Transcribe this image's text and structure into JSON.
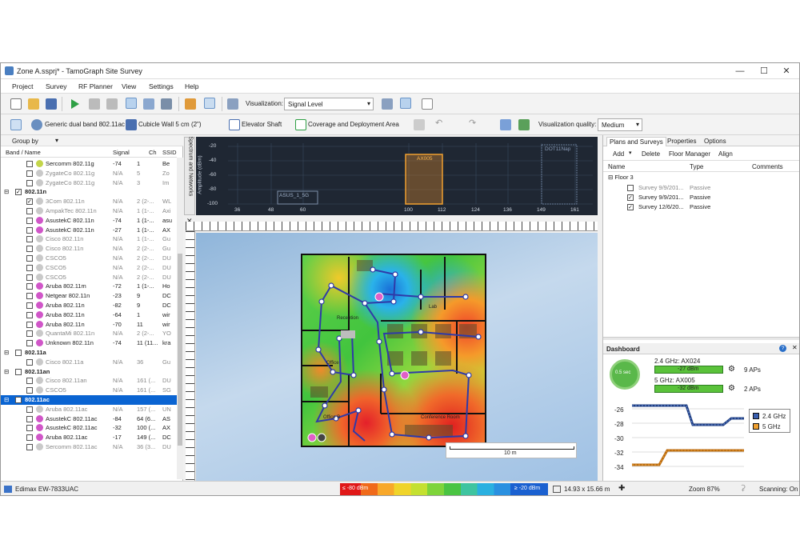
{
  "window": {
    "title": "Zone A.ssprj* - TamoGraph Site Survey"
  },
  "menu": [
    "Project",
    "Survey",
    "RF Planner",
    "View",
    "Settings",
    "Help"
  ],
  "toolbar1": {
    "visualization_label": "Visualization:",
    "visualization_value": "Signal Level"
  },
  "toolbar2": {
    "ap_model": "Generic dual band 802.11ac",
    "wall": "Cubicle Wall 5 cm (2\")",
    "elevator": "Elevator Shaft",
    "coverage": "Coverage and Deployment Area",
    "quality_label": "Visualization quality:",
    "quality_value": "Medium"
  },
  "left": {
    "group_by": "Group by",
    "headers": [
      "Band / Name",
      "Signal",
      "Ch",
      "SSID"
    ],
    "rows": [
      {
        "name": "Sercomm 802.11g",
        "signal": "-74",
        "ch": "1",
        "ssid": "Be",
        "indent": 2,
        "dot": "#c3d54a",
        "gray": false
      },
      {
        "name": "ZygateCo 802.11g",
        "signal": "N/A",
        "ch": "5",
        "ssid": "Zo",
        "indent": 2,
        "dot": "#c9c9c9",
        "gray": true
      },
      {
        "name": "ZygateCo 802.11g",
        "signal": "N/A",
        "ch": "3",
        "ssid": "Im",
        "indent": 2,
        "dot": "#c9c9c9",
        "gray": true
      },
      {
        "name": "802.11n",
        "signal": "",
        "ch": "",
        "ssid": "",
        "indent": 0,
        "group": true,
        "checked": true
      },
      {
        "name": "3Com 802.11n",
        "signal": "N/A",
        "ch": "2 (2-...",
        "ssid": "WL",
        "indent": 2,
        "dot": "#c9c9c9",
        "gray": true,
        "checked": true
      },
      {
        "name": "AmpakTec 802.11n",
        "signal": "N/A",
        "ch": "1 (1-...",
        "ssid": "Axi",
        "indent": 2,
        "dot": "#c9c9c9",
        "gray": true
      },
      {
        "name": "AsustekC 802.11n",
        "signal": "-74",
        "ch": "1 (1-...",
        "ssid": "asu",
        "indent": 2,
        "dot": "#d056c8",
        "gray": false
      },
      {
        "name": "AsustekC 802.11n",
        "signal": "-27",
        "ch": "1 (1-...",
        "ssid": "AX",
        "indent": 2,
        "dot": "#d056c8",
        "gray": false
      },
      {
        "name": "Cisco 802.11n",
        "signal": "N/A",
        "ch": "1 (1-...",
        "ssid": "Gu",
        "indent": 2,
        "dot": "#c9c9c9",
        "gray": true
      },
      {
        "name": "Cisco 802.11n",
        "signal": "N/A",
        "ch": "2 (2-...",
        "ssid": "Gu",
        "indent": 2,
        "dot": "#c9c9c9",
        "gray": true
      },
      {
        "name": "CSCO5",
        "signal": "N/A",
        "ch": "2 (2-...",
        "ssid": "DU",
        "indent": 2,
        "dot": "#c9c9c9",
        "gray": true
      },
      {
        "name": "CSCO5",
        "signal": "N/A",
        "ch": "2 (2-...",
        "ssid": "DU",
        "indent": 2,
        "dot": "#c9c9c9",
        "gray": true
      },
      {
        "name": "CSCO5",
        "signal": "N/A",
        "ch": "2 (2-...",
        "ssid": "DU",
        "indent": 2,
        "dot": "#c9c9c9",
        "gray": true
      },
      {
        "name": "Aruba 802.11m",
        "signal": "-72",
        "ch": "1 (1-...",
        "ssid": "Ho",
        "indent": 2,
        "dot": "#d056c8",
        "gray": false
      },
      {
        "name": "Netgear 802.11n",
        "signal": "-23",
        "ch": "9",
        "ssid": "DC",
        "indent": 2,
        "dot": "#d056c8",
        "gray": false
      },
      {
        "name": "Aruba 802.11n",
        "signal": "-82",
        "ch": "9",
        "ssid": "DC",
        "indent": 2,
        "dot": "#d056c8",
        "gray": false
      },
      {
        "name": "Aruba 802.11n",
        "signal": "-64",
        "ch": "1",
        "ssid": "wir",
        "indent": 2,
        "dot": "#d056c8",
        "gray": false
      },
      {
        "name": "Aruba 802.11n",
        "signal": "-70",
        "ch": "11",
        "ssid": "wir",
        "indent": 2,
        "dot": "#d056c8",
        "gray": false
      },
      {
        "name": "QuantaMi 802.11n",
        "signal": "N/A",
        "ch": "2 (2-...",
        "ssid": "YO",
        "indent": 2,
        "dot": "#c9c9c9",
        "gray": true
      },
      {
        "name": "Unknown 802.11n",
        "signal": "-74",
        "ch": "11 (11...",
        "ssid": "kra",
        "indent": 2,
        "dot": "#d056c8",
        "gray": false
      },
      {
        "name": "802.11a",
        "signal": "",
        "ch": "",
        "ssid": "",
        "indent": 0,
        "group": true
      },
      {
        "name": "Cisco 802.11a",
        "signal": "N/A",
        "ch": "36",
        "ssid": "Gu",
        "indent": 2,
        "dot": "#c9c9c9",
        "gray": true
      },
      {
        "name": "802.11an",
        "signal": "",
        "ch": "",
        "ssid": "",
        "indent": 0,
        "group": true
      },
      {
        "name": "Cisco 802.11an",
        "signal": "N/A",
        "ch": "161 (...",
        "ssid": "DU",
        "indent": 2,
        "dot": "#c9c9c9",
        "gray": true
      },
      {
        "name": "CSCO5",
        "signal": "N/A",
        "ch": "161 (...",
        "ssid": "SG",
        "indent": 2,
        "dot": "#c9c9c9",
        "gray": true
      },
      {
        "name": "802.11ac",
        "signal": "",
        "ch": "",
        "ssid": "",
        "indent": 0,
        "group": true,
        "selected": true
      },
      {
        "name": "Aruba 802.11ac",
        "signal": "N/A",
        "ch": "157 (...",
        "ssid": "UN",
        "indent": 2,
        "dot": "#c9c9c9",
        "gray": true
      },
      {
        "name": "AsustekC 802.11ac",
        "signal": "-84",
        "ch": "64 (6...",
        "ssid": "AS",
        "indent": 2,
        "dot": "#d056c8",
        "gray": false
      },
      {
        "name": "AsustekC 802.11ac",
        "signal": "-32",
        "ch": "100 (...",
        "ssid": "AX",
        "indent": 2,
        "dot": "#d056c8",
        "gray": false
      },
      {
        "name": "Aruba 802.11ac",
        "signal": "-17",
        "ch": "149 (...",
        "ssid": "DC",
        "indent": 2,
        "dot": "#d056c8",
        "gray": false
      },
      {
        "name": "Sercomm 802.11ac",
        "signal": "N/A",
        "ch": "36 (3...",
        "ssid": "DU",
        "indent": 2,
        "dot": "#c9c9c9",
        "gray": true
      }
    ]
  },
  "spectrum": {
    "tab_label": "Spectrum and Networks",
    "ylabel": "Amplitude (dBm)",
    "yticks": [
      "-20",
      "-40",
      "-60",
      "-80",
      "-100"
    ],
    "xticks": [
      "36",
      "48",
      "60",
      "100",
      "112",
      "124",
      "136",
      "149",
      "161"
    ],
    "networks": [
      "ASUS_1_5G",
      "AX005",
      "DOT11Nap"
    ]
  },
  "map": {
    "labels": [
      "Reception",
      "Office",
      "Office B",
      "Conference Room",
      "Lab"
    ],
    "scale": "10 m"
  },
  "right": {
    "tabs": [
      "Plans and Surveys",
      "Properties",
      "Options"
    ],
    "actions": [
      "Add",
      "Delete",
      "Floor Manager",
      "Align"
    ],
    "headers": [
      "Name",
      "Type",
      "Comments"
    ],
    "floor": "Floor 3",
    "surveys": [
      {
        "name": "Survey 9/9/201...",
        "type": "Passive",
        "checked": false,
        "gray": true
      },
      {
        "name": "Survey 9/9/201...",
        "type": "Passive",
        "checked": true,
        "gray": false
      },
      {
        "name": "Survey 12/6/20...",
        "type": "Passive",
        "checked": true,
        "gray": false
      }
    ]
  },
  "dashboard": {
    "title": "Dashboard",
    "timer": "0.5 sec",
    "band24": "2.4 GHz: AX024",
    "val24": "-27 dBm",
    "aps24": "9 APs",
    "band5": "5 GHz: AX005",
    "val5": "-32 dBm",
    "aps5": "2 APs",
    "yticks": [
      "-26",
      "-28",
      "-30",
      "-32",
      "-34"
    ],
    "legend": [
      "2.4 GHz",
      "5 GHz"
    ]
  },
  "status": {
    "adapter": "Edimax EW-7833UAC",
    "min": "≤ -80 dBm",
    "max": "≥ -20 dBm",
    "size": "14.93 x 15.66 m",
    "zoom": "Zoom 87%",
    "scanning": "Scanning: On"
  },
  "colors": {
    "accent": "#0a64d2",
    "bar24": "#3a5fb0",
    "bar5": "#f0a030"
  }
}
